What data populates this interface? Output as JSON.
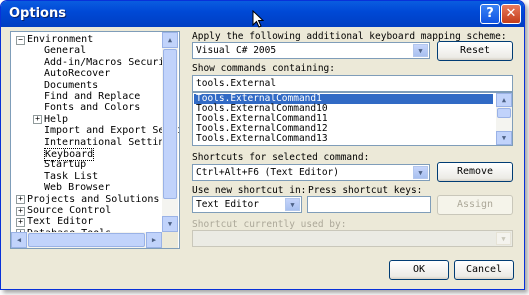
{
  "window": {
    "title": "Options",
    "help_label": "?",
    "close_label": "✕"
  },
  "tree": {
    "items": [
      {
        "label": "Environment",
        "expander": "−"
      },
      {
        "label": "General"
      },
      {
        "label": "Add-in/Macros Security"
      },
      {
        "label": "AutoRecover"
      },
      {
        "label": "Documents"
      },
      {
        "label": "Find and Replace"
      },
      {
        "label": "Fonts and Colors"
      },
      {
        "label": "Help",
        "expander": "+"
      },
      {
        "label": "Import and Export Settin"
      },
      {
        "label": "International Settings"
      },
      {
        "label": "Keyboard",
        "selected": true
      },
      {
        "label": "Startup"
      },
      {
        "label": "Task List"
      },
      {
        "label": "Web Browser"
      },
      {
        "label": "Projects and Solutions",
        "expander": "+"
      },
      {
        "label": "Source Control",
        "expander": "+"
      },
      {
        "label": "Text Editor",
        "expander": "+"
      },
      {
        "label": "Database Tools",
        "expander": "+"
      }
    ]
  },
  "mapping": {
    "label": "Apply the following additional keyboard mapping scheme:",
    "value": "Visual C# 2005",
    "reset_label": "Reset"
  },
  "commands": {
    "label": "Show commands containing:",
    "search_value": "tools.External",
    "items": [
      {
        "label": "Tools.ExternalCommand1",
        "selected": true
      },
      {
        "label": "Tools.ExternalCommand10"
      },
      {
        "label": "Tools.ExternalCommand11"
      },
      {
        "label": "Tools.ExternalCommand12"
      },
      {
        "label": "Tools.ExternalCommand13"
      }
    ]
  },
  "shortcuts": {
    "label": "Shortcuts for selected command:",
    "value": "Ctrl+Alt+F6 (Text Editor)",
    "remove_label": "Remove"
  },
  "new_shortcut": {
    "label": "Use new shortcut in:",
    "value": "Text Editor",
    "press_label": "Press shortcut keys:",
    "press_value": "",
    "assign_label": "Assign"
  },
  "currently_used": {
    "label": "Shortcut currently used by:",
    "value": ""
  },
  "footer": {
    "ok_label": "OK",
    "cancel_label": "Cancel"
  },
  "icons": {
    "scroll_up": "▲",
    "scroll_down": "▼",
    "scroll_left": "◀",
    "scroll_right": "▶",
    "dropdown": "▼"
  }
}
